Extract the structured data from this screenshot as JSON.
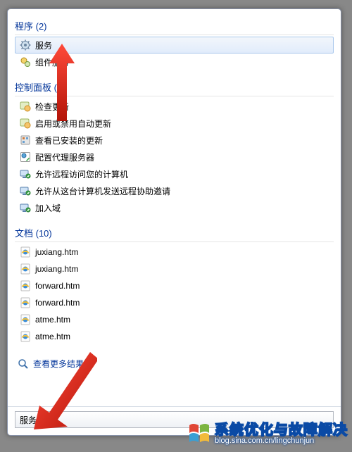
{
  "sections": {
    "programs": {
      "header": "程序 (2)"
    },
    "controlPanel": {
      "header": "控制面板 (9)"
    },
    "documents": {
      "header": "文档 (10)"
    }
  },
  "programItems": [
    {
      "label": "服务",
      "selected": true
    },
    {
      "label": "组件服务",
      "selected": false
    }
  ],
  "cpItems": [
    {
      "label": "检查更新"
    },
    {
      "label": "启用或禁用自动更新"
    },
    {
      "label": "查看已安装的更新"
    },
    {
      "label": "配置代理服务器"
    },
    {
      "label": "允许远程访问您的计算机"
    },
    {
      "label": "允许从这台计算机发送远程协助邀请"
    },
    {
      "label": "加入域"
    }
  ],
  "docItems": [
    {
      "label": "juxiang.htm"
    },
    {
      "label": "juxiang.htm"
    },
    {
      "label": "forward.htm"
    },
    {
      "label": "forward.htm"
    },
    {
      "label": "atme.htm"
    },
    {
      "label": "atme.htm"
    }
  ],
  "moreResults": "查看更多结果",
  "search": {
    "value": "服务"
  },
  "watermark": {
    "title": "系统优化与故障解决",
    "url": "blog.sina.com.cn/lingchunjun"
  }
}
